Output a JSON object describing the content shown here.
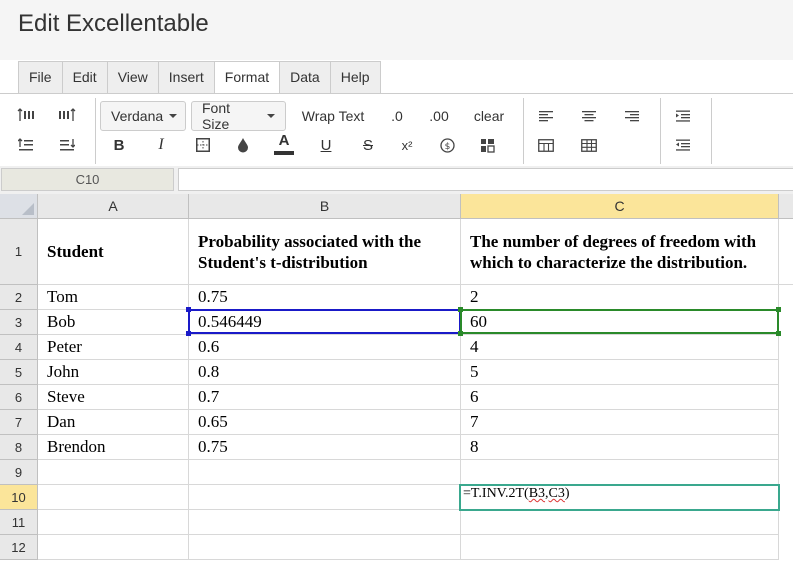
{
  "app": {
    "title": "Edit Excellentable"
  },
  "menu": [
    "File",
    "Edit",
    "View",
    "Insert",
    "Format",
    "Data",
    "Help"
  ],
  "toolbar": {
    "font_family": "Verdana",
    "font_size": "Font Size",
    "wrap_text": "Wrap Text",
    "decimal_decrease": ".0",
    "decimal_increase": ".00",
    "clear": "clear",
    "bold": "B",
    "italic": "I",
    "strike": "S",
    "font_color_glyph": "A",
    "underline": "U",
    "superscript": "x²"
  },
  "name_box": "C10",
  "columns": [
    "A",
    "B",
    "C"
  ],
  "rows": [
    "1",
    "2",
    "3",
    "4",
    "5",
    "6",
    "7",
    "8",
    "9",
    "10",
    "11",
    "12"
  ],
  "sheet": {
    "header": {
      "a": "Student",
      "b": "Probability associated with the Student's t-distribution",
      "c": "The number of degrees of freedom with which to characterize the distribution."
    },
    "data": [
      {
        "a": "Tom",
        "b": "0.75",
        "c": "2"
      },
      {
        "a": "Bob",
        "b": "0.546449",
        "c": "60"
      },
      {
        "a": "Peter",
        "b": "0.6",
        "c": "4"
      },
      {
        "a": "John",
        "b": "0.8",
        "c": "5"
      },
      {
        "a": "Steve",
        "b": "0.7",
        "c": "6"
      },
      {
        "a": "Dan",
        "b": "0.65",
        "c": "7"
      },
      {
        "a": "Brendon",
        "b": "0.75",
        "c": "8"
      }
    ],
    "formula": {
      "prefix": "=T.INV.2T(",
      "arg1": "B3",
      "sep": ", ",
      "arg2": "C3",
      "suffix": ")"
    }
  },
  "colors": {
    "selected_header": "#fbe59a",
    "ref_blue": "#1a1ac8",
    "ref_green": "#2a8a2a",
    "active_cell": "#3aa88e"
  }
}
